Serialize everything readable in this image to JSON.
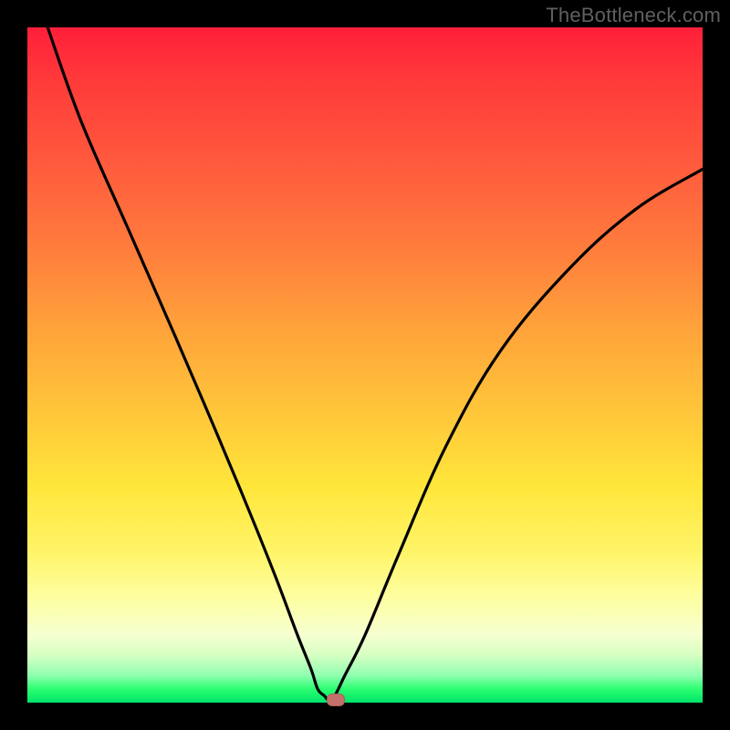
{
  "watermark": "TheBottleneck.com",
  "colors": {
    "curve": "#000000",
    "marker_fill": "#c4716b"
  },
  "chart_data": {
    "type": "line",
    "title": "",
    "xlabel": "",
    "ylabel": "",
    "xlim": [
      0,
      100
    ],
    "ylim": [
      0,
      100
    ],
    "note": "Axes are unlabeled; values are pixel-position estimates on a 0–100 scale.",
    "series": [
      {
        "name": "bottleneck-curve",
        "x": [
          3,
          8,
          15,
          22,
          28,
          33,
          37,
          40,
          42,
          43,
          44,
          44.5,
          45.5,
          47,
          50,
          55,
          62,
          70,
          80,
          90,
          100
        ],
        "y": [
          100,
          86,
          70,
          54,
          40,
          28,
          18,
          10,
          5,
          2,
          1,
          0.5,
          1,
          4,
          10,
          22,
          38,
          52,
          64,
          73,
          79
        ]
      }
    ],
    "marker": {
      "x_pct": 45.5,
      "y_pct": 0.5
    },
    "grid": false,
    "legend": false
  }
}
